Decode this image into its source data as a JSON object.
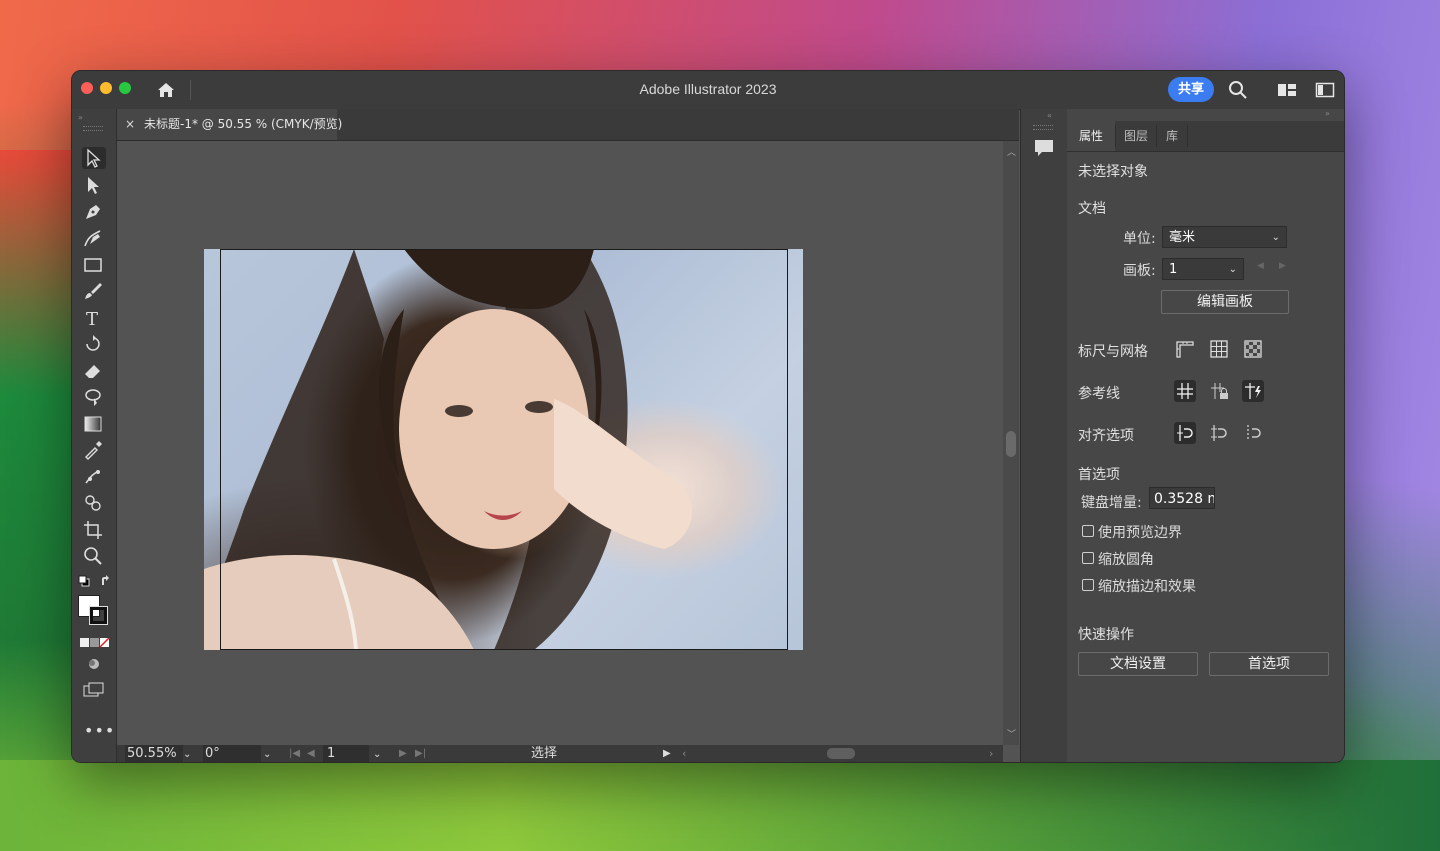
{
  "app": {
    "title": "Adobe Illustrator 2023",
    "share_label": "共享"
  },
  "document_tab": {
    "close_glyph": "×",
    "label": "未标题-1* @ 50.55 % (CMYK/预览)"
  },
  "status_bar": {
    "zoom": "50.55%",
    "rotation": "0°",
    "artboard_number": "1",
    "mode": "选择"
  },
  "panel": {
    "tabs": [
      {
        "label": "属性",
        "active": true
      },
      {
        "label": "图层",
        "active": false
      },
      {
        "label": "库",
        "active": false
      }
    ],
    "no_selection": "未选择对象",
    "document_section": "文档",
    "units_label": "单位:",
    "units_value": "毫米",
    "artboard_label": "画板:",
    "artboard_value": "1",
    "edit_artboards_button": "编辑画板",
    "rulers_grids_label": "标尺与网格",
    "guides_label": "参考线",
    "snap_options_label": "对齐选项",
    "preferences_section": "首选项",
    "keyboard_increment_label": "键盘增量:",
    "keyboard_increment_value": "0.3528 m",
    "checkboxes": [
      {
        "label": "使用预览边界",
        "checked": false
      },
      {
        "label": "缩放圆角",
        "checked": false
      },
      {
        "label": "缩放描边和效果",
        "checked": false
      }
    ],
    "quick_actions_section": "快速操作",
    "doc_setup_button": "文档设置",
    "preferences_button": "首选项"
  },
  "colors": {
    "accent": "#3b7cf0",
    "window_bg": "#535353",
    "panel_bg": "#474747"
  }
}
